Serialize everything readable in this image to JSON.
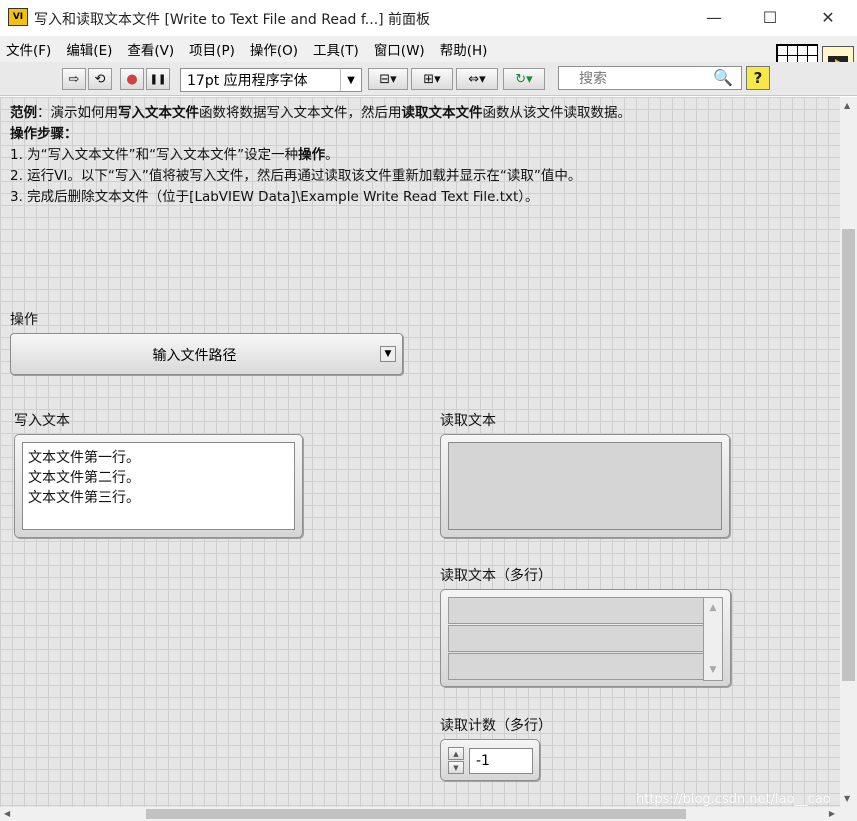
{
  "window": {
    "title": "写入和读取文本文件 [Write to Text File and Read f...] 前面板",
    "app_icon_text": "VI",
    "minimize": "—",
    "maximize": "☐",
    "close": "✕"
  },
  "menu": [
    "文件(F)",
    "编辑(E)",
    "查看(V)",
    "项目(P)",
    "操作(O)",
    "工具(T)",
    "窗口(W)",
    "帮助(H)"
  ],
  "toolbar": {
    "run": "⇨",
    "run_continuous": "⟲",
    "abort": "●",
    "pause": "❚❚",
    "font": "17pt 应用程序字体",
    "font_arrow": "▼",
    "align": "⊟▾",
    "distribute": "⊞▾",
    "resize": "⇔▾",
    "reorder": "↻▾",
    "search_placeholder": "搜索",
    "search_icon": "🔍",
    "help": "?"
  },
  "description": {
    "line1_prefix": "范例",
    "line1_a": "：演示如何用",
    "line1_b": "写入文本文件",
    "line1_c": "函数将数据写入文本文件，然后用",
    "line1_d": "读取文本文件",
    "line1_e": "函数从该文件读取数据。",
    "line2": "操作步骤：",
    "line3_a": "1. 为“写入文本文件”和“写入文本文件”设定一种",
    "line3_b": "操作",
    "line3_c": "。",
    "line4": "2. 运行VI。以下“写入”值将被写入文件，然后再通过读取该文件重新加载并显示在“读取”值中。",
    "line5": "3. 完成后删除文本文件（位于[LabVIEW Data]\\Example Write Read Text File.txt）。"
  },
  "operation": {
    "label": "操作",
    "value": "输入文件路径",
    "dd": "▼"
  },
  "write_text": {
    "label": "写入文本",
    "lines": [
      "文本文件第一行。",
      "文本文件第二行。",
      "文本文件第三行。"
    ]
  },
  "read_text": {
    "label": "读取文本"
  },
  "read_text_multi": {
    "label": "读取文本（多行）",
    "up": "▲",
    "down": "▼"
  },
  "read_count": {
    "label": "读取计数（多行）",
    "value": "-1",
    "inc": "▲",
    "dec": "▼"
  },
  "watermark": "https://blog.csdn.net/lao__cao",
  "scroll": {
    "up": "▲",
    "down": "▼",
    "left": "◀",
    "right": "▶"
  }
}
